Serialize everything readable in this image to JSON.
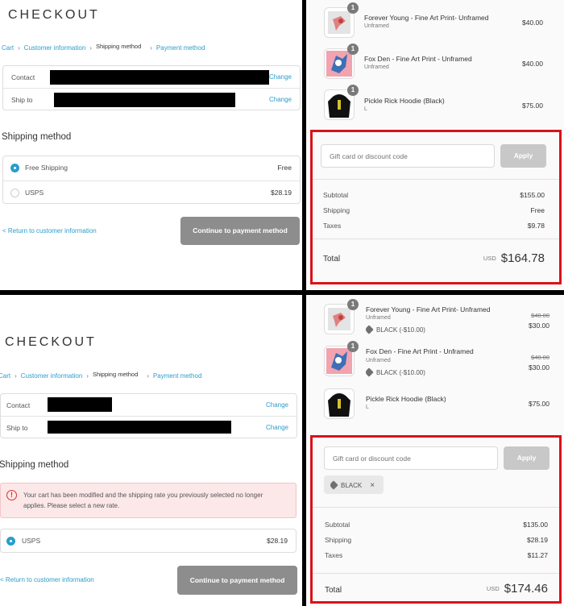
{
  "top": {
    "checkout": {
      "logo": "CHECKOUT",
      "breadcrumb": {
        "cart": "Cart",
        "customer": "Customer information",
        "shipping": "Shipping method",
        "payment": "Payment method"
      },
      "contact": {
        "label": "Contact",
        "change": "Change"
      },
      "ship_to": {
        "label": "Ship to",
        "change": "Change"
      },
      "heading": "Shipping method",
      "options": [
        {
          "label": "Free Shipping",
          "price": "Free",
          "selected": true
        },
        {
          "label": "USPS",
          "price": "$28.19",
          "selected": false
        }
      ],
      "back_link": "< Return to customer information",
      "continue_button": "Continue to payment method"
    },
    "summary": {
      "items": [
        {
          "qty": "1",
          "name": "Forever Young - Fine Art Print- Unframed",
          "variant": "Unframed",
          "price": "$40.00"
        },
        {
          "qty": "1",
          "name": "Fox Den - Fine Art Print - Unframed",
          "variant": "Unframed",
          "price": "$40.00"
        },
        {
          "qty": "1",
          "name": "Pickle Rick Hoodie (Black)",
          "variant": "L",
          "price": "$75.00"
        }
      ],
      "discount_placeholder": "Gift card or discount code",
      "apply": "Apply",
      "subtotal": {
        "label": "Subtotal",
        "value": "$155.00"
      },
      "shipping": {
        "label": "Shipping",
        "value": "Free"
      },
      "taxes": {
        "label": "Taxes",
        "value": "$9.78"
      },
      "total": {
        "label": "Total",
        "currency": "USD",
        "value": "$164.78"
      }
    }
  },
  "bottom": {
    "checkout": {
      "logo": "CHECKOUT",
      "breadcrumb": {
        "cart": "Cart",
        "customer": "Customer information",
        "shipping": "Shipping method",
        "payment": "Payment method"
      },
      "contact": {
        "label": "Contact",
        "change": "Change"
      },
      "ship_to": {
        "label": "Ship to",
        "change": "Change"
      },
      "heading": "Shipping method",
      "alert": "Your cart has been modified and the shipping rate you previously selected no longer applies. Please select a new rate.",
      "options": [
        {
          "label": "USPS",
          "price": "$28.19",
          "selected": true
        }
      ],
      "back_link": "< Return to customer information",
      "continue_button": "Continue to payment method"
    },
    "summary": {
      "items": [
        {
          "qty": "1",
          "name": "Forever Young - Fine Art Print- Unframed",
          "variant": "Unframed",
          "discount": "BLACK (-$10.00)",
          "original_price": "$40.00",
          "price": "$30.00"
        },
        {
          "qty": "1",
          "name": "Fox Den - Fine Art Print - Unframed",
          "variant": "Unframed",
          "discount": "BLACK (-$10.00)",
          "original_price": "$40.00",
          "price": "$30.00"
        },
        {
          "qty": "1",
          "name": "Pickle Rick Hoodie (Black)",
          "variant": "L",
          "price": "$75.00"
        }
      ],
      "discount_placeholder": "Gift card or discount code",
      "apply": "Apply",
      "applied_code": "BLACK",
      "subtotal": {
        "label": "Subtotal",
        "value": "$135.00"
      },
      "shipping": {
        "label": "Shipping",
        "value": "$28.19"
      },
      "taxes": {
        "label": "Taxes",
        "value": "$11.27"
      },
      "total": {
        "label": "Total",
        "currency": "USD",
        "value": "$174.46"
      }
    }
  },
  "colors": {
    "link": "#2a9dcc",
    "highlight_border": "#d8131a",
    "alert_bg": "#fce8e8",
    "error": "#d53131"
  }
}
